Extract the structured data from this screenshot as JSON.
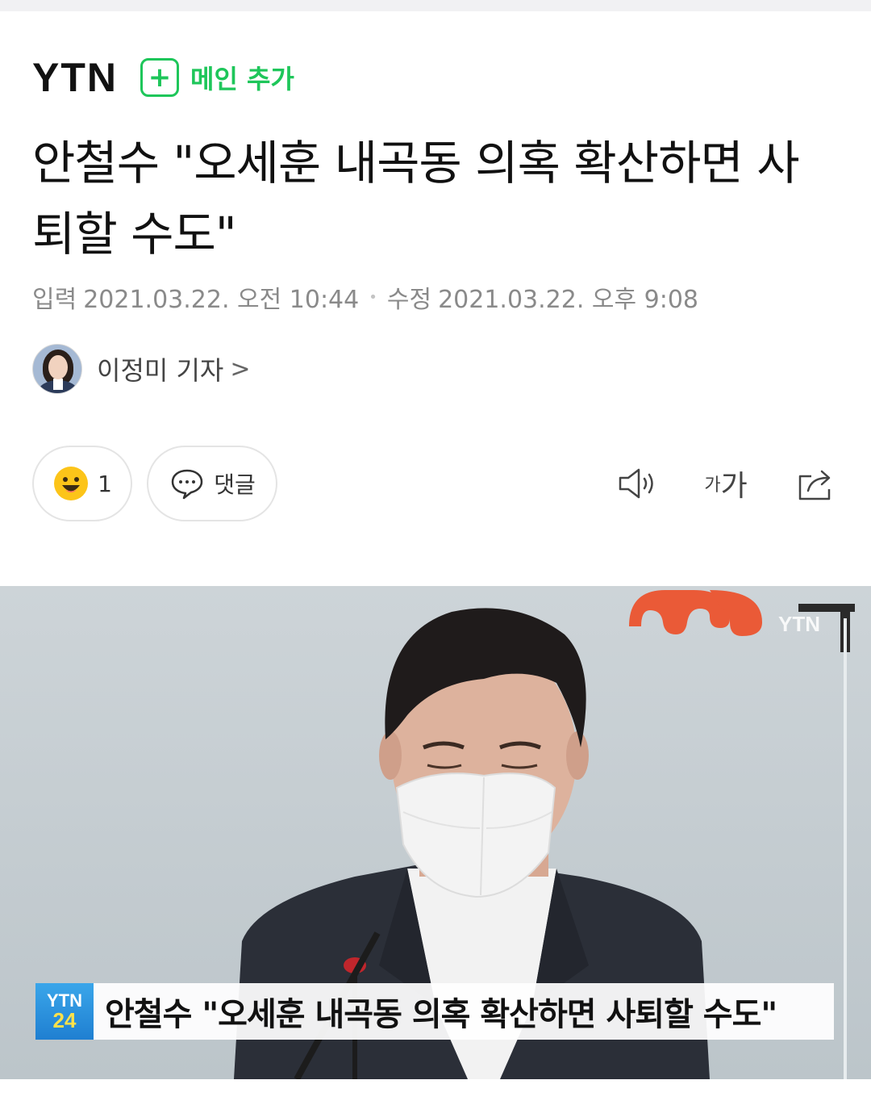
{
  "header": {
    "logo_text": "YTN",
    "subscribe_plus": "+",
    "subscribe_label": "메인 추가",
    "accent_color": "#1ec65a"
  },
  "article": {
    "headline": "안철수 \"오세훈 내곡동 의혹 확산하면 사퇴할 수도\"",
    "published_label": "입력",
    "published": "2021.03.22. 오전 10:44",
    "modified_label": "수정",
    "modified": "2021.03.22. 오후 9:08",
    "author": "이정미 기자",
    "author_chevron": ">"
  },
  "actions": {
    "reaction_count": "1",
    "comment_label": "댓글",
    "font_small": "가",
    "font_big": "가",
    "icons": [
      "smiley-icon",
      "comment-bubble-icon",
      "speaker-icon",
      "font-size-icon",
      "share-icon"
    ]
  },
  "photo": {
    "watermark": "YTN",
    "badge_top": "YTN",
    "badge_bottom": "24",
    "caption": "안철수 \"오세훈 내곡동 의혹 확산하면 사퇴할 수도\""
  }
}
